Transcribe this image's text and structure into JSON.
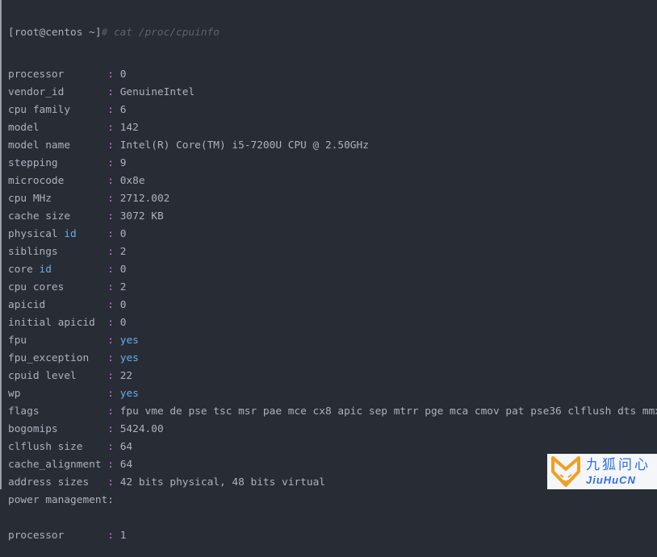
{
  "prompt": {
    "text": "[root@centos ~]",
    "command": "# cat /proc/cpuinfo"
  },
  "colors": {
    "background": "#282c34",
    "text": "#abb2bf",
    "keyword": "#61afef",
    "colon": "#c678dd",
    "comment": "#5c6370"
  },
  "lines": [
    {
      "key": "processor",
      "pad": "\t",
      "value": "0"
    },
    {
      "key": "vendor_id",
      "pad": "\t",
      "value": "GenuineIntel"
    },
    {
      "key": "cpu family",
      "pad": "\t",
      "value": "6"
    },
    {
      "key": "model",
      "pad": "\t\t",
      "value": "142"
    },
    {
      "key": "model name",
      "pad": "\t",
      "value": "Intel(R) Core(TM) i5-7200U CPU @ 2.50GHz"
    },
    {
      "key": "stepping",
      "pad": "\t",
      "value": "9"
    },
    {
      "key": "microcode",
      "pad": "\t",
      "value": "0x8e"
    },
    {
      "key": "cpu MHz",
      "pad": "\t\t",
      "value": "2712.002"
    },
    {
      "key": "cache size",
      "pad": "\t",
      "value": "3072 KB"
    },
    {
      "key": "physical id",
      "pad": "\t",
      "value": "0"
    },
    {
      "key": "siblings",
      "pad": "\t",
      "value": "2"
    },
    {
      "key": "core id",
      "pad": "\t\t",
      "value": "0"
    },
    {
      "key": "cpu cores",
      "pad": "\t",
      "value": "2"
    },
    {
      "key": "apicid",
      "pad": "\t\t",
      "value": "0"
    },
    {
      "key": "initial apicid",
      "pad": "\t",
      "value": "0"
    },
    {
      "key": "fpu",
      "pad": "\t\t",
      "value": "yes"
    },
    {
      "key": "fpu_exception",
      "pad": "\t",
      "value": "yes"
    },
    {
      "key": "cpuid level",
      "pad": "\t",
      "value": "22"
    },
    {
      "key": "wp",
      "pad": "\t\t",
      "value": "yes"
    },
    {
      "key": "flags",
      "pad": "\t\t",
      "value": "fpu vme de pse tsc msr pae mce cx8 apic sep mtrr pge mca cmov pat pse36 clflush dts mmx fxs"
    },
    {
      "key": "bogomips",
      "pad": "\t",
      "value": "5424.00"
    },
    {
      "key": "clflush size",
      "pad": "\t",
      "value": "64"
    },
    {
      "key": "cache_alignment",
      "pad": "\t",
      "value": "64"
    },
    {
      "key": "address sizes",
      "pad": "\t",
      "value": "42 bits physical, 48 bits virtual"
    },
    {
      "key": "power management",
      "pad": "",
      "value": "",
      "plain_colon": true
    },
    {
      "blank": true
    },
    {
      "key": "processor",
      "pad": "\t",
      "value": "1"
    }
  ],
  "watermark": {
    "logo_icon": "fox-logo-icon",
    "chinese": "九狐问心",
    "english": "JiuHuCN"
  }
}
